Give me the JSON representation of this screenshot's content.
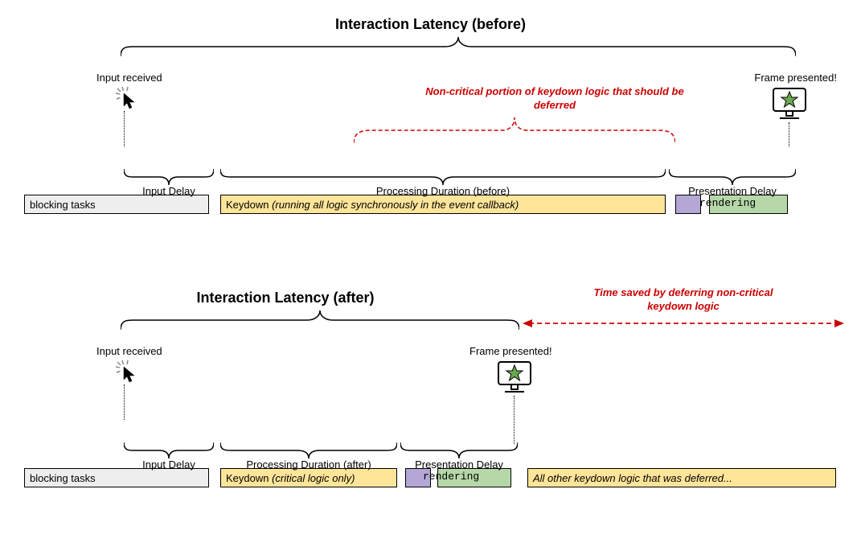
{
  "before": {
    "title": "Interaction Latency (before)",
    "input_received": "Input received",
    "frame_presented": "Frame presented!",
    "red_annotation": "Non-critical portion of keydown logic that should be deferred",
    "bars": {
      "blocking": "blocking tasks",
      "keydown_prefix": "Keydown ",
      "keydown_italic": "(running all logic synchronously in the event callback)",
      "rendering": "rendering"
    },
    "sub": {
      "input_delay": "Input Delay",
      "processing": "Processing Duration (before)",
      "presentation": "Presentation Delay"
    }
  },
  "after": {
    "title": "Interaction Latency (after)",
    "input_received": "Input received",
    "frame_presented": "Frame presented!",
    "red_annotation": "Time saved by deferring non-critical keydown logic",
    "bars": {
      "blocking": "blocking tasks",
      "keydown_prefix": "Keydown ",
      "keydown_italic": "(critical logic only)",
      "rendering": "rendering",
      "deferred": "All other keydown logic that was deferred..."
    },
    "sub": {
      "input_delay": "Input Delay",
      "processing": "Processing Duration (after)",
      "presentation": "Presentation Delay"
    }
  }
}
